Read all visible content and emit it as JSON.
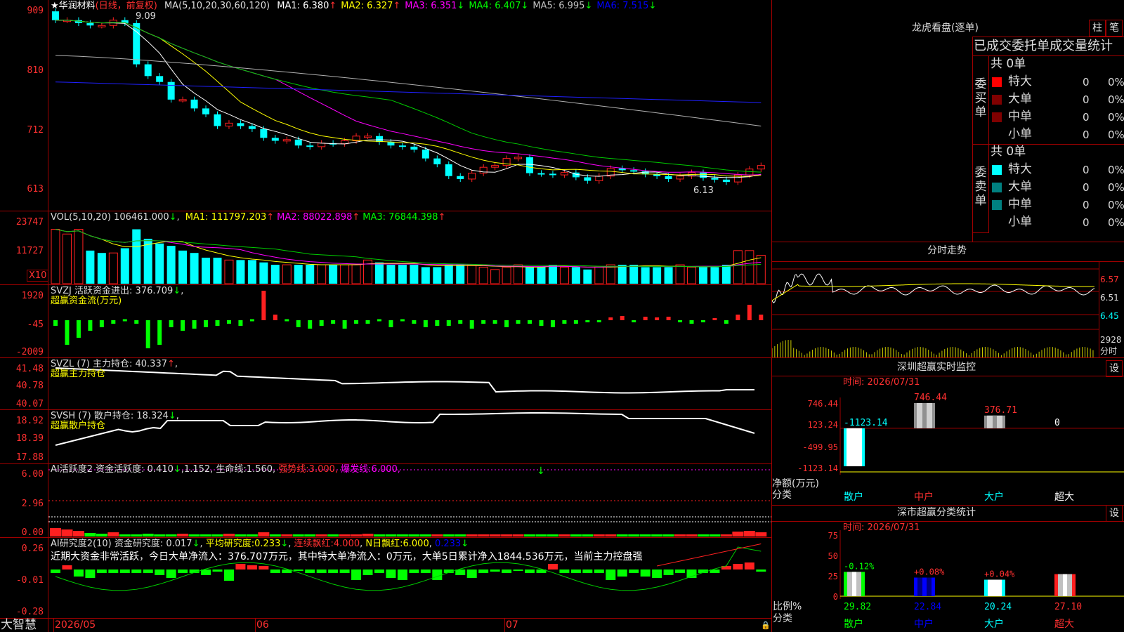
{
  "main_chart": {
    "title": "★华润材料",
    "period": "(日线，前复权)",
    "ma_label": "MA(5,10,20,30,60,120)",
    "ma_values": [
      {
        "label": "MA1:",
        "value": "6.380",
        "arrow": "↑",
        "color": "#ffffff"
      },
      {
        "label": "MA2:",
        "value": "6.327",
        "arrow": "↑",
        "color": "#ffff00"
      },
      {
        "label": "MA3:",
        "value": "6.351",
        "arrow": "↓",
        "color": "#ff00ff"
      },
      {
        "label": "MA4:",
        "value": "6.407",
        "arrow": "↓",
        "color": "#00ff00"
      },
      {
        "label": "MA5:",
        "value": "6.995",
        "arrow": "↓",
        "color": "#c0c0c0"
      },
      {
        "label": "MA6:",
        "value": "7.515",
        "arrow": "↓",
        "color": "#0000ff"
      }
    ],
    "y_ticks": [
      "909",
      "810",
      "712",
      "613"
    ],
    "high_marker": "9.09",
    "low_marker": "6.13"
  },
  "volume": {
    "label": "VOL(5,10,20)",
    "value": "106461.000",
    "ma": [
      {
        "label": "MA1:",
        "value": "111797.203",
        "arrow": "↑",
        "color": "#ffff00"
      },
      {
        "label": "MA2:",
        "value": "88022.898",
        "arrow": "↑",
        "color": "#ff00ff"
      },
      {
        "label": "MA3:",
        "value": "76844.398",
        "arrow": "↑",
        "color": "#00ff00"
      }
    ],
    "y_ticks": [
      "23747",
      "11727"
    ],
    "unit": "X10"
  },
  "svzj": {
    "label": "SVZJ  活跃资金进出:",
    "value": "376.709",
    "arrow": "↓",
    "subtitle": "超赢资金流(万元)",
    "y_ticks": [
      "1920",
      "-45",
      "-2009"
    ]
  },
  "svzl": {
    "label": "SVZL (7) 主力持仓:",
    "value": "40.337",
    "arrow": "↑",
    "subtitle": "超赢主力持仓",
    "y_ticks": [
      "41.48",
      "40.78",
      "40.07"
    ]
  },
  "svsh": {
    "label": "SVSH (7) 散户持仓:",
    "value": "18.324",
    "arrow": "↓",
    "subtitle": "超赢散户持仓",
    "y_ticks": [
      "18.92",
      "18.39",
      "17.88"
    ]
  },
  "ai_active": {
    "label": "AI活跃度2 资金活跃度:",
    "value": "0.410",
    "v2": "1.152",
    "life_label": "生命线:",
    "life": "1.560",
    "strong_label": "强势线:",
    "strong": "3.000",
    "burst_label": "爆发线:",
    "burst": "6.000",
    "y_ticks": [
      "6.00",
      "2.96",
      "0.00"
    ]
  },
  "ai_research": {
    "label": "AI研究度2(10) 资金研究度:",
    "value": "0.017",
    "avg_label": "平均研究度:",
    "avg": "0.233",
    "cont_label": "连续飘红:",
    "cont": "4.000",
    "n_label": "N日飘红:",
    "n": "6.000",
    "last": "0.233",
    "comment": "近期大资金非常活跃，今日大单净流入：376.707万元，其中特大单净流入：0万元，大单5日累计净入1844.536万元，当前主力控盘强",
    "y_ticks": [
      "0.26",
      "-0.01",
      "-0.28"
    ]
  },
  "bottom": {
    "brand": "大智慧",
    "dates": [
      "2026/05",
      "06",
      "07"
    ]
  },
  "dragon": {
    "title": "龙虎看盘(逐单)",
    "btn1": "柱",
    "btn2": "笔",
    "header": "已成交委托单成交量统计",
    "buy_label": "委买单",
    "sell_label": "委卖单",
    "buy_total": "共 0单",
    "sell_total": "共 0单",
    "rows": [
      "特大",
      "大单",
      "中单",
      "小单"
    ],
    "val": "0",
    "pct": "0%",
    "buy_colors": [
      "#ff0000",
      "#800000",
      "#800000",
      "#000000"
    ],
    "sell_colors": [
      "#00ffff",
      "#008080",
      "#008080",
      "#000000"
    ]
  },
  "fenshi": {
    "title": "分时走势",
    "y_ticks": [
      "6.57",
      "6.51",
      "6.45"
    ],
    "vol": "2928",
    "unit": "分时"
  },
  "monitor": {
    "title": "深圳超赢实时监控",
    "btn": "设",
    "time": "时间: 2026/07/31",
    "y_ticks": [
      "746.44",
      "123.24",
      "-499.95",
      "-1123.14"
    ],
    "axis_label": "净额(万元)",
    "cat_label": "分类",
    "cats": [
      "散户",
      "中户",
      "大户",
      "超大"
    ],
    "values": [
      -1123.14,
      746.44,
      376.71,
      0
    ],
    "value_labels": [
      "-1123.14",
      "746.44",
      "376.71",
      "0"
    ]
  },
  "classify": {
    "title": "深市超赢分类统计",
    "btn": "设",
    "time": "时间: 2026/07/31",
    "y_ticks": [
      "75",
      "50",
      "25",
      "0"
    ],
    "axis_label": "比例%",
    "cat_label": "分类",
    "cats": [
      "散户",
      "中户",
      "大户",
      "超大"
    ],
    "values": [
      29.82,
      22.84,
      20.24,
      27.1
    ],
    "value_labels": [
      "29.82",
      "22.84",
      "20.24",
      "27.10"
    ],
    "change_labels": [
      "-0.12%",
      "+0.08%",
      "+0.04%",
      ""
    ]
  }
}
